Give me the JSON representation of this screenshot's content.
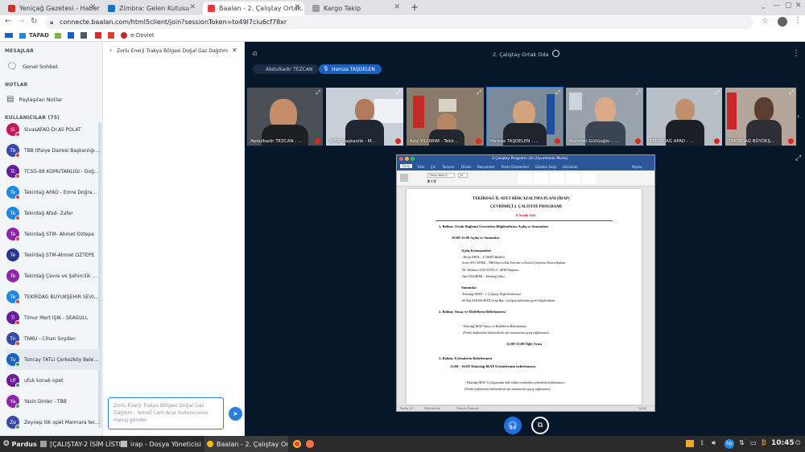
{
  "browser": {
    "tabs": [
      {
        "label": "Yeniçağ Gazetesi - Haber...",
        "color": "#c0392b"
      },
      {
        "label": "Zimbra: Gelen Kutusu",
        "color": "#1a73b8"
      },
      {
        "label": "Baalan - 2. Çalıştay Ortak...",
        "color": "#e53935"
      },
      {
        "label": "Kargo Takip",
        "color": "#9e9e9e"
      }
    ],
    "new_tab": "+",
    "url": "connecte.baalan.com/html5client/join?sessionToken=to49l7ciu6cf78xr",
    "bookmarks": [
      "TAFAD",
      "e-Devlet"
    ]
  },
  "sidebar": {
    "messages_title": "MESAJLAR",
    "public_chat": "Genel Sohbet",
    "notes_title": "NOTLAR",
    "shared_notes": "Paylaşılan Notlar",
    "users_title": "KULLANICILAR (75)",
    "users": [
      {
        "initials": "Si",
        "name": "SivasAFAD-Dr.Ali POLAT",
        "color": "#c2185b"
      },
      {
        "initials": "Tb",
        "name": "TBB İtfaiye Dairesi Başkanlığı - ...",
        "color": "#3949ab"
      },
      {
        "initials": "Tc",
        "name": "TCSG-88 KOMUTANLIĞI - Doğuk...",
        "color": "#6a1b9a"
      },
      {
        "initials": "Te",
        "name": "Tekirdağ AFAD - Emre Doğramacı",
        "color": "#1e88e5"
      },
      {
        "initials": "Te",
        "name": "Tekirdağ Afad- Zafer",
        "color": "#1e88e5"
      },
      {
        "initials": "Te",
        "name": "Tekirdağ STM- Ahmet Öztepe",
        "color": "#8e24aa"
      },
      {
        "initials": "Te",
        "name": "Tekirdağ STM-Ahmet ÖZTEPE",
        "color": "#283593"
      },
      {
        "initials": "Te",
        "name": "Tekirdağ Çevre ve Şehircilik Ha...",
        "color": "#8e24aa"
      },
      {
        "initials": "Te",
        "name": "TEKİRDAĞ BÜYÜKŞEHİR SEVİM ...",
        "color": "#1e88e5"
      },
      {
        "initials": "Ti",
        "name": "Timur Mert IŞIK - SEAGULL",
        "color": "#6a1b9a"
      },
      {
        "initials": "Tn",
        "name": "TNKÜ - Cihan Soydan",
        "color": "#3949ab"
      },
      {
        "initials": "Tu",
        "name": "Tuncay TATLI Çerkezköy Beledi...",
        "color": "#1565c0"
      },
      {
        "initials": "Uf",
        "name": "ufuk konak opet",
        "color": "#6a1b9a"
      },
      {
        "initials": "Ya",
        "name": "Yasin Dinler - TBB",
        "color": "#8e24aa"
      },
      {
        "initials": "Ze",
        "name": "Zeynep lök opet Marmara term...",
        "color": "#3949ab"
      }
    ]
  },
  "chat": {
    "title": "Zorlu Enerji Trakya Bölgesi Doğal Gaz Dağıtım - İsmai...",
    "input_placeholder": "Zorlu Enerji Trakya Bölgesi Doğal Gaz Dağıtım - İsmail Cem Acar kullanıcısına mesaj gönder"
  },
  "meeting": {
    "room_title": "2. Çalıştay Ortak Oda",
    "presenters": [
      "Abdulkadir TEZCAN",
      "Hamza TAŞDELEN"
    ],
    "video_tiles": [
      "Abdulkadir TEZCAN - ...",
      "AFAD Başkanlık - M...",
      "Aziz YILDIRIM - Tekir...",
      "Hamza TAŞDELEN - ...",
      "Mehmet Güllüoğlu - ...",
      "TEKİRDAĞ AFAD - ...",
      "TEKİRDAĞ BÜYÜKŞ..."
    ]
  },
  "document": {
    "window_title": "2.Çalıştay Programı (4) [Uyumluluk Modu]",
    "ribbon_tabs": [
      "Giriş",
      "Ekle",
      "Çiz",
      "Tasarım",
      "Düzen",
      "Başvurular",
      "Posta Gönderileri",
      "Gözden Geçir",
      "Görünüm"
    ],
    "share_label": "Paylaş",
    "font_name": "Times New R...",
    "font_size": "12",
    "heading1": "TEKİRDAĞ İL AFET RİSK AZALTMA PLANI (İRAP)",
    "heading2": "ÇEVRİMİÇİ 2. ÇALIŞTAY PROGRAMI",
    "date": "8 Aralık Salı",
    "section1": "1. Bölüm: Ortak Bağlantı Üzerinden Bilgilendirme Açılış ve Sunumları",
    "time1": "10:00-11:00 Açılış ve Sunumlar",
    "opening_title": "Açılış Konuşmaları",
    "opening_items": [
      "- Recep EROL – İl AFAD Müdürü",
      "-Sevim AVCI YENER – TBB Deprem Risk Yönetimi ve Kentsel İyileştirme Dairesi Başkanı",
      "-Dr. Mehmet GÜLLÜOĞLU- AFAD Başkanı",
      "-Aziz YILDIRIM – Tekirdağ Valisi"
    ],
    "talks_title": "Sunumlar",
    "talks_items": [
      "-Tekirdağ AFAD - 1. Çalıştay Değerlendirmesi",
      "-M.Akif ALKAN/AFAD Grup Bşk.- Çalıştay hakkında genel bilgilendirme"
    ],
    "section2": "2. Bölüm: Amaç ve Hedeflerin Belirlenmesi",
    "section2_item": "- Tekirdağ İRAP Amaç ve Hedeflerin Belirlenmesi",
    "section2_note": "(Farklı bağlantılar kullanılarak afet masalarına geçiş sağlanması)",
    "lunch": "12:00-13:00 Öğle Arası",
    "section3": "3. Bölüm: Eylemlerin Belirlenmesi",
    "time3": "13:00 - 16:00 Tekirdağ İRAP Eylemlerinin belirlenmesi,",
    "section3_item": "- Tekirdağ İRAP 1.Çalıştaydan elde edilen verilerden eylemlerin belirlenmesi",
    "section3_note": "(Farklı bağlantılar kullanılarak afet masalarına geçiş sağlanması)",
    "status_left": "Sayfa 1/1",
    "status_words": "398 sözcük",
    "status_lang": "Türkçe (Türkiye)",
    "zoom": "%100"
  },
  "taskbar": {
    "start_label": "Pardus",
    "items": [
      "[ÇALIŞTAY-2 İSİM LİSTESİ...",
      "irap - Dosya Yöneticisi",
      "Baalan - 2. Çalıştay Ort..."
    ],
    "clock": "10:45"
  }
}
